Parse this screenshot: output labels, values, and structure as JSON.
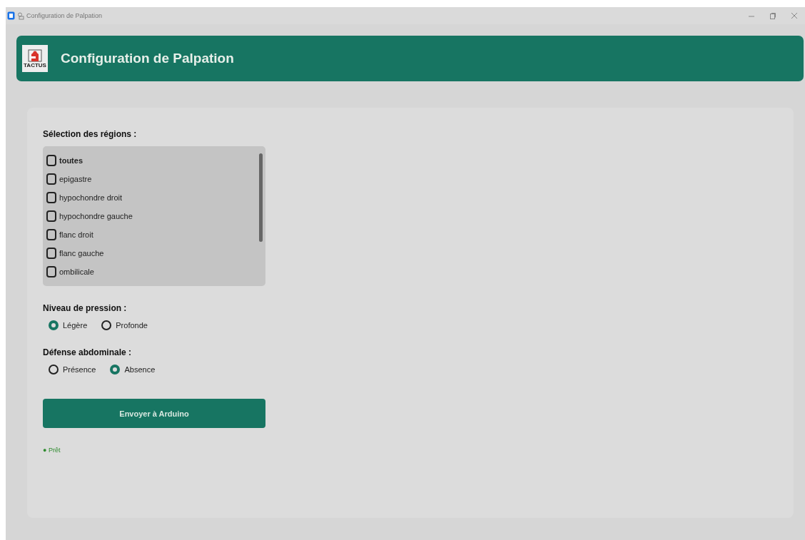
{
  "window": {
    "title": "Configuration de Palpation"
  },
  "header": {
    "title": "Configuration de Palpation",
    "logo_text": "TACTUS"
  },
  "regions": {
    "label": "Sélection des régions :",
    "items": [
      {
        "label": "toutes",
        "checked": false,
        "kind": "all"
      },
      {
        "label": "epigastre",
        "checked": false,
        "kind": "region"
      },
      {
        "label": "hypochondre droit",
        "checked": false,
        "kind": "region"
      },
      {
        "label": "hypochondre gauche",
        "checked": false,
        "kind": "region"
      },
      {
        "label": "flanc droit",
        "checked": false,
        "kind": "region"
      },
      {
        "label": "flanc gauche",
        "checked": false,
        "kind": "region"
      },
      {
        "label": "ombilicale",
        "checked": false,
        "kind": "region"
      }
    ]
  },
  "pressure": {
    "label": "Niveau de pression :",
    "options": [
      {
        "label": "Légère",
        "selected": true
      },
      {
        "label": "Profonde",
        "selected": false
      }
    ]
  },
  "defense": {
    "label": "Défense abdominale :",
    "options": [
      {
        "label": "Présence",
        "selected": false
      },
      {
        "label": "Absence",
        "selected": true
      }
    ]
  },
  "send_button": "Envoyer à Arduino",
  "status": {
    "text": "● Prêt",
    "color": "#2e8b2e"
  }
}
